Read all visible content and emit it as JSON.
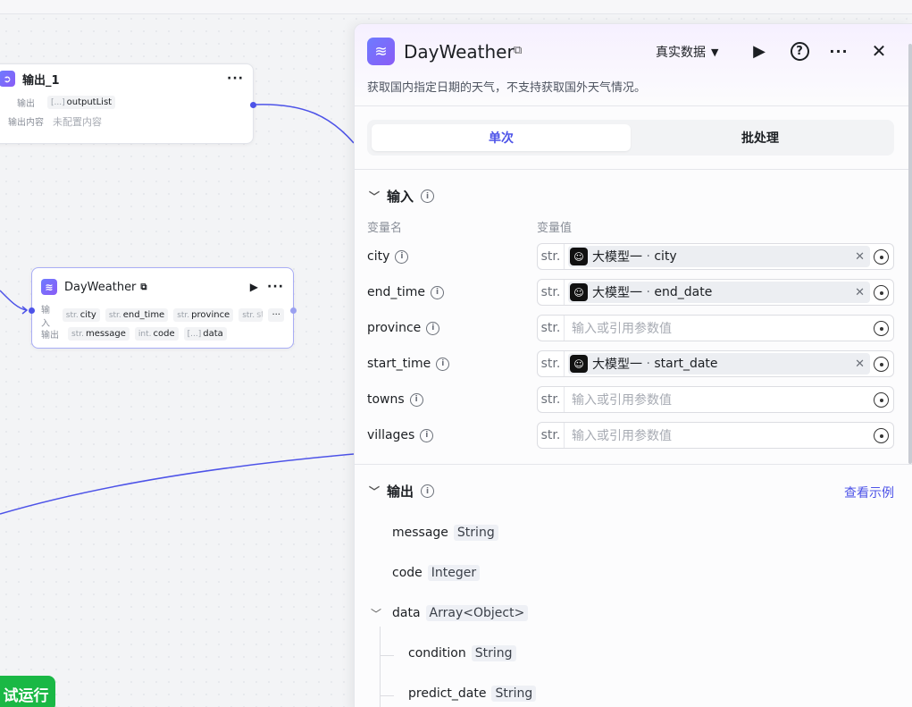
{
  "canvas": {
    "output_node": {
      "title": "输出_1",
      "output_label": "输出",
      "output_var": "outputList",
      "content_label": "输出内容",
      "content_value": "未配置内容"
    },
    "weather_node": {
      "title": "DayWeather",
      "input_label": "输入",
      "inputs": [
        {
          "type": "str.",
          "name": "city"
        },
        {
          "type": "str.",
          "name": "end_time"
        },
        {
          "type": "str.",
          "name": "province"
        },
        {
          "type": "str.",
          "name": "sta"
        }
      ],
      "output_label": "输出",
      "outputs": [
        {
          "type": "str.",
          "name": "message"
        },
        {
          "type": "int.",
          "name": "code"
        },
        {
          "type": "[...]",
          "name": "data"
        }
      ]
    },
    "run_button": "试运行",
    "edge_color": "#4d53e8"
  },
  "panel": {
    "title": "DayWeather",
    "description": "获取国内指定日期的天气，不支持获取国外天气情况。",
    "mode_label": "真实数据",
    "tabs": [
      "单次",
      "批处理"
    ],
    "active_tab": "单次",
    "input_section": {
      "title": "输入",
      "col_name": "变量名",
      "col_value": "变量值",
      "params": [
        {
          "name": "city",
          "type": "str.",
          "ref_source": "大模型一",
          "ref_var": "city",
          "placeholder": ""
        },
        {
          "name": "end_time",
          "type": "str.",
          "ref_source": "大模型一",
          "ref_var": "end_date",
          "placeholder": ""
        },
        {
          "name": "province",
          "type": "str.",
          "ref_source": "",
          "ref_var": "",
          "placeholder": "输入或引用参数值"
        },
        {
          "name": "start_time",
          "type": "str.",
          "ref_source": "大模型一",
          "ref_var": "start_date",
          "placeholder": ""
        },
        {
          "name": "towns",
          "type": "str.",
          "ref_source": "",
          "ref_var": "",
          "placeholder": "输入或引用参数值"
        },
        {
          "name": "villages",
          "type": "str.",
          "ref_source": "",
          "ref_var": "",
          "placeholder": "输入或引用参数值"
        }
      ]
    },
    "output_section": {
      "title": "输出",
      "example_link": "查看示例",
      "fields": [
        {
          "name": "message",
          "type": "String"
        },
        {
          "name": "code",
          "type": "Integer"
        },
        {
          "name": "data",
          "type": "Array<Object>"
        },
        {
          "name": "condition",
          "type": "String"
        },
        {
          "name": "predict_date",
          "type": "String"
        }
      ]
    },
    "accent_color": "#4d53e8"
  }
}
